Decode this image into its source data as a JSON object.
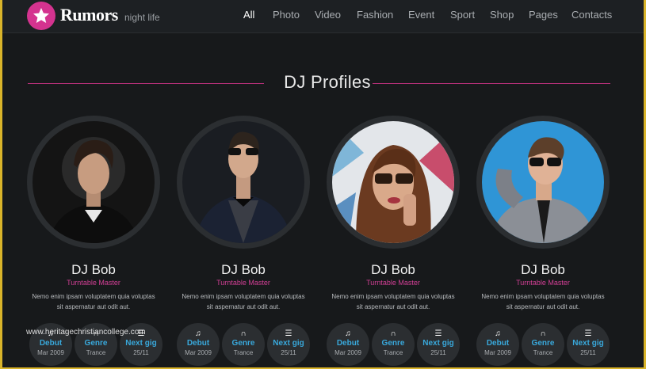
{
  "brand": {
    "name": "Rumors",
    "tagline": "night life"
  },
  "nav": [
    "All",
    "Photo",
    "Video",
    "Fashion",
    "Event",
    "Sport",
    "Shop",
    "Pages",
    "Contacts"
  ],
  "nav_active": "All",
  "section_title": "DJ Profiles",
  "cards": [
    {
      "name": "DJ Bob",
      "role": "Turntable Master",
      "desc": "Nemo enim ipsam voluptatem quia voluptas sit aspernatur aut odit aut.",
      "stats": [
        {
          "icon": "music-note-icon",
          "label": "Debut",
          "value": "Mar 2009"
        },
        {
          "icon": "headphones-icon",
          "label": "Genre",
          "value": "Trance"
        },
        {
          "icon": "sliders-icon",
          "label": "Next gig",
          "value": "25/11"
        }
      ]
    },
    {
      "name": "DJ Bob",
      "role": "Turntable Master",
      "desc": "Nemo enim ipsam voluptatem quia voluptas sit aspernatur aut odit aut.",
      "stats": [
        {
          "icon": "music-note-icon",
          "label": "Debut",
          "value": "Mar 2009"
        },
        {
          "icon": "headphones-icon",
          "label": "Genre",
          "value": "Trance"
        },
        {
          "icon": "sliders-icon",
          "label": "Next gig",
          "value": "25/11"
        }
      ]
    },
    {
      "name": "DJ Bob",
      "role": "Turntable Master",
      "desc": "Nemo enim ipsam voluptatem quia voluptas sit aspernatur aut odit aut.",
      "stats": [
        {
          "icon": "music-note-icon",
          "label": "Debut",
          "value": "Mar 2009"
        },
        {
          "icon": "headphones-icon",
          "label": "Genre",
          "value": "Trance"
        },
        {
          "icon": "sliders-icon",
          "label": "Next gig",
          "value": "25/11"
        }
      ]
    },
    {
      "name": "DJ Bob",
      "role": "Turntable Master",
      "desc": "Nemo enim ipsam voluptatem quia voluptas sit aspernatur aut odit aut.",
      "stats": [
        {
          "icon": "music-note-icon",
          "label": "Debut",
          "value": "Mar 2009"
        },
        {
          "icon": "headphones-icon",
          "label": "Genre",
          "value": "Trance"
        },
        {
          "icon": "sliders-icon",
          "label": "Next gig",
          "value": "25/11"
        }
      ]
    }
  ],
  "watermark": "www.heritagechristiancollege.com",
  "colors": {
    "accent": "#d4338f",
    "link": "#39a9dc",
    "background": "#17191b",
    "frame": "#d9b42a"
  }
}
